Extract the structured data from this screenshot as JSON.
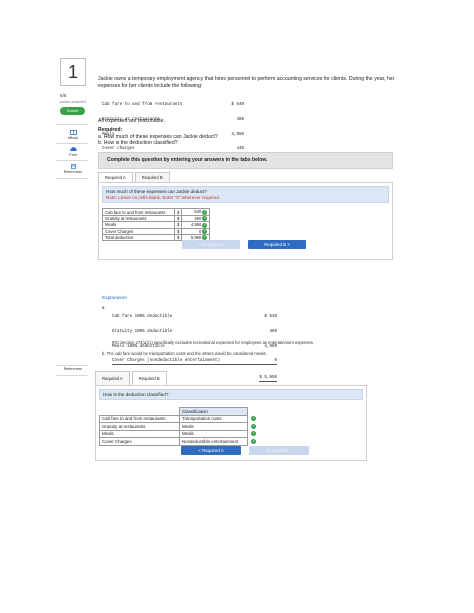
{
  "question": {
    "number": "1",
    "score": "5/5",
    "points_label": "points awarded",
    "scored_label": "Scored"
  },
  "sidebar": {
    "ebook": "eBook",
    "print": "Print",
    "references": "References"
  },
  "problem": {
    "intro": "Jackie owns a temporary employment agency that hires personnel to perform accounting services for clients. During the year, her expenses for her clients include the following:",
    "expenses": [
      {
        "label": "Cab fare to and from restaurants",
        "amount": "$ 540"
      },
      {
        "label": "Gratuity at restaurants",
        "amount": "460"
      },
      {
        "label": "Meals",
        "amount": "4,950"
      },
      {
        "label": "Cover charges",
        "amount": "440"
      }
    ],
    "all_reasonable": "All expenses are reasonable.",
    "required_heading": "Required:",
    "required_a": "a. How much of these expenses can Jackie deduct?",
    "required_b": "b. How is the deduction classified?"
  },
  "instruction": "Complete this question by entering your answers in the tabs below.",
  "panel_a": {
    "tabs": [
      "Required A",
      "Required B"
    ],
    "question": "How much of these expenses can Jackie deduct?",
    "note": "Note: Leave no cells blank. Enter \"0\" wherever required.",
    "rows": [
      {
        "label": "Cab fare to and from restaurants",
        "dollar": "$",
        "value": "540"
      },
      {
        "label": "Gratuity at restaurants",
        "dollar": "$",
        "value": "460"
      },
      {
        "label": "Meals",
        "dollar": "$",
        "value": "4,950"
      },
      {
        "label": "Cover Charges",
        "dollar": "$",
        "value": "0"
      },
      {
        "label": "Total deduction",
        "dollar": "$",
        "value": "5,950"
      }
    ],
    "prev_button": "< Required A",
    "next_button": "Required B >"
  },
  "explanation": {
    "title": "Explanation",
    "part_a": "a.",
    "lines": [
      {
        "label": "Cab fare 100% deductible",
        "amount": "$ 540"
      },
      {
        "label": "Gratuity 100% deductible",
        "amount": "460"
      },
      {
        "label": "Meals 100% deductible",
        "amount": "4,950"
      },
      {
        "label": "Cover Charges (nondeductible entertainment)",
        "amount": "0"
      },
      {
        "label": "Total deduction",
        "amount": "$ 5,950"
      }
    ],
    "irc_note": "IRC Section 274(a)(1) specifically excludes recreational expenses for employees as entertainment expenses.",
    "part_b": "b. The cab fare would be transportation costs and the others would be considered meals."
  },
  "panel_b": {
    "tabs": [
      "Required A",
      "Required B"
    ],
    "question": "How is the deduction classified?",
    "header": "Classification",
    "rows": [
      {
        "label": "Cab fare to and from restaurants",
        "value": "Transportation costs"
      },
      {
        "label": "Gratuity at restaurants",
        "value": "Meals"
      },
      {
        "label": "Meals",
        "value": "Meals"
      },
      {
        "label": "Cover Charges",
        "value": "Nondeductible entertainment"
      }
    ],
    "prev_button": "< Required A",
    "next_button": "Required B >"
  },
  "colors": {
    "accent": "#2f6bc0",
    "success": "#3aa04a",
    "header_blue": "#dbe7f5"
  }
}
